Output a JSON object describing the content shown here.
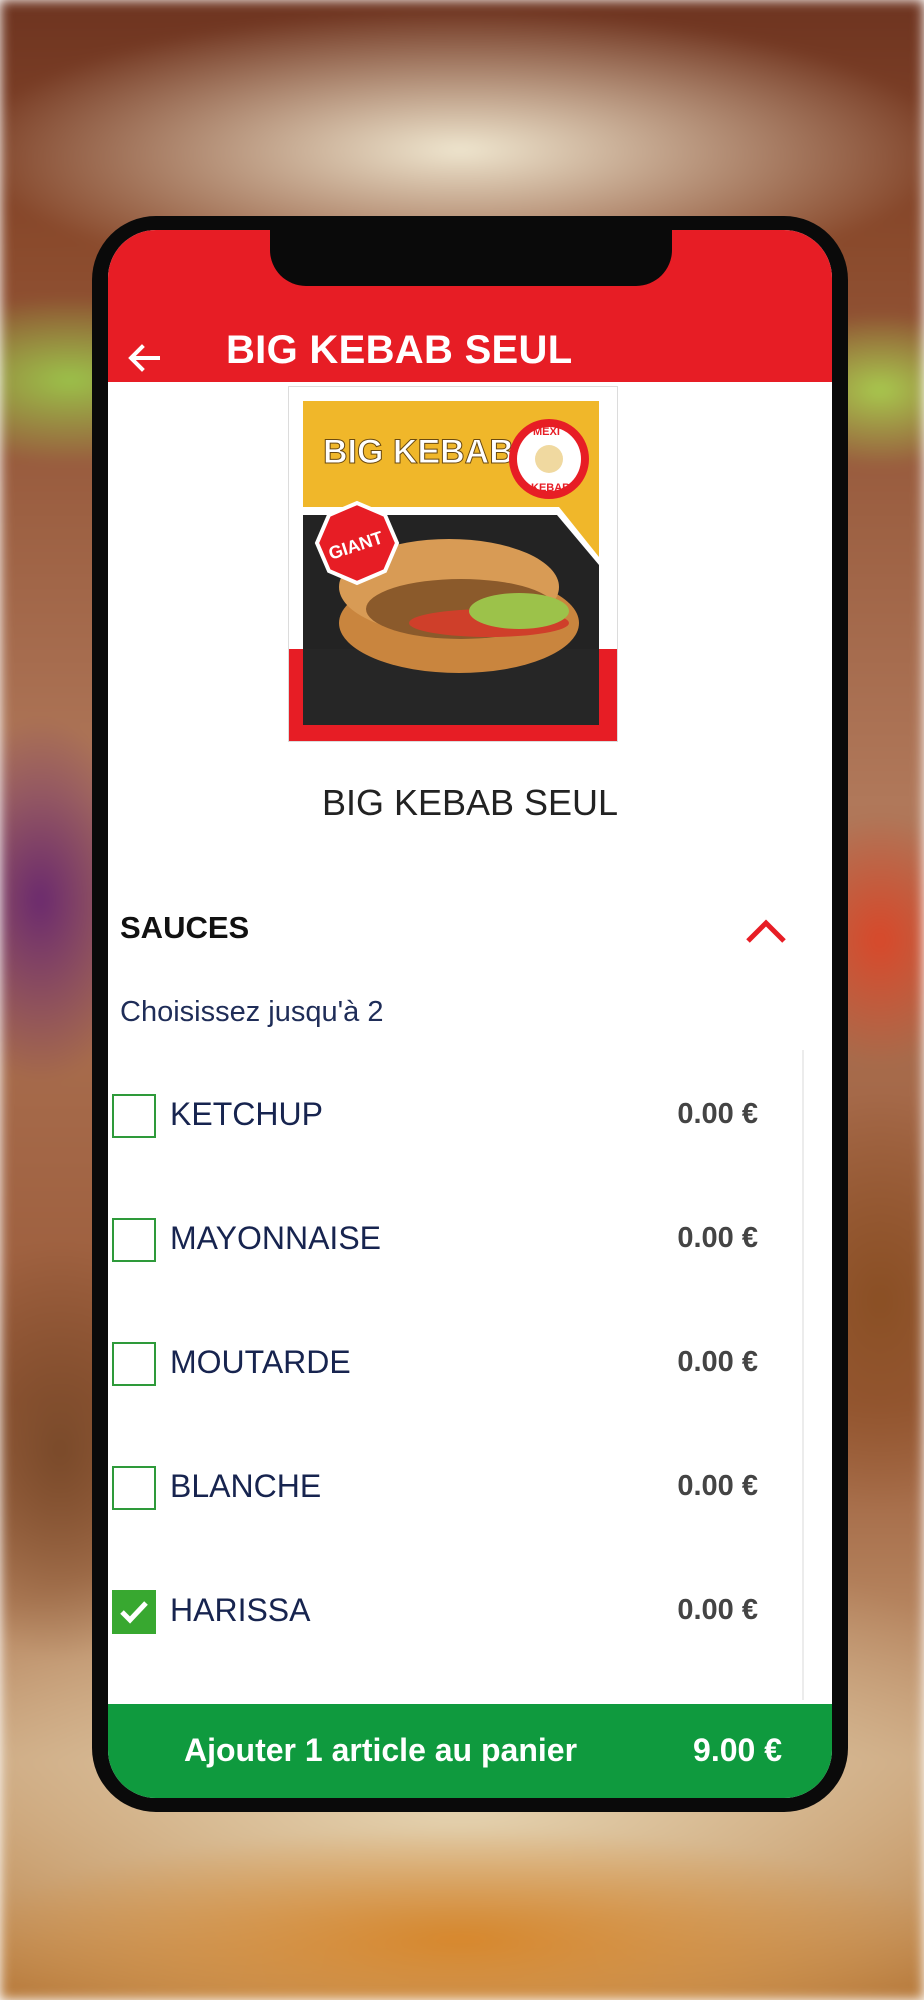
{
  "appbar": {
    "title": "BIG KEBAB SEUL"
  },
  "product": {
    "name": "BIG KEBAB SEUL",
    "image": {
      "banner_text": "BIG KEBAB",
      "badge_text": "GIANT",
      "logo_top": "MEXI",
      "logo_bottom": "KEBAB"
    }
  },
  "section": {
    "title": "SAUCES",
    "subtitle": "Choisissez jusqu'à 2",
    "options": [
      {
        "label": "KETCHUP",
        "price": "0.00 €",
        "checked": false
      },
      {
        "label": "MAYONNAISE",
        "price": "0.00 €",
        "checked": false
      },
      {
        "label": "MOUTARDE",
        "price": "0.00 €",
        "checked": false
      },
      {
        "label": "BLANCHE",
        "price": "0.00 €",
        "checked": false
      },
      {
        "label": "HARISSA",
        "price": "0.00 €",
        "checked": true
      }
    ]
  },
  "cart": {
    "label": "Ajouter 1 article au panier",
    "total": "9.00 €"
  },
  "colors": {
    "brand_red": "#e71d25",
    "cart_green": "#0f9a3e",
    "check_green": "#38a830"
  }
}
